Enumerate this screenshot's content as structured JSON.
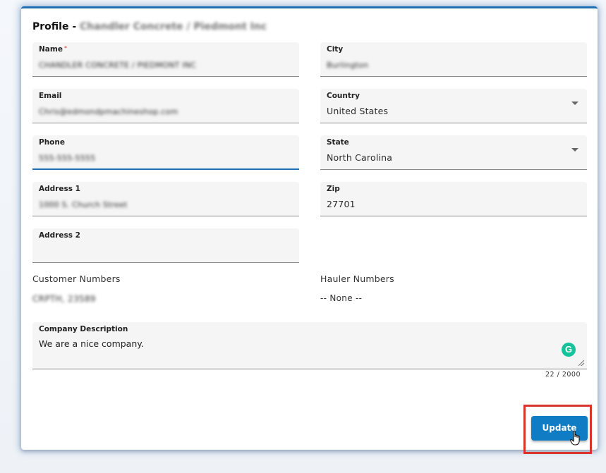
{
  "profile": {
    "title_prefix": "Profile -",
    "title_company": "Chandler Concrete / Piedmont Inc"
  },
  "fields": {
    "name": {
      "label": "Name",
      "required_mark": "*",
      "value": "CHANDLER CONCRETE / PIEDMONT INC"
    },
    "city": {
      "label": "City",
      "value": "Burlington"
    },
    "email": {
      "label": "Email",
      "value": "Chris@edmondpmachineshop.com"
    },
    "country": {
      "label": "Country",
      "value": "United States"
    },
    "phone": {
      "label": "Phone",
      "value": "555-555-5555"
    },
    "state": {
      "label": "State",
      "value": "North Carolina"
    },
    "address1": {
      "label": "Address 1",
      "value": "1000 S. Church Street"
    },
    "zip": {
      "label": "Zip",
      "value": "27701"
    },
    "address2": {
      "label": "Address 2",
      "value": ""
    }
  },
  "customer_numbers": {
    "label": "Customer Numbers",
    "value": "CRPTH, 23589"
  },
  "hauler_numbers": {
    "label": "Hauler Numbers",
    "value": "-- None --"
  },
  "company_description": {
    "label": "Company Description",
    "value": "We are a nice company.",
    "counter": "22 / 2000",
    "grammarly_glyph": "G"
  },
  "actions": {
    "update_label": "Update"
  },
  "colors": {
    "accent": "#0f7cc4",
    "highlight": "#d9342b",
    "grammarly": "#15c39a"
  },
  "icons": [
    "dropdown-caret-icon",
    "grammarly-icon",
    "resize-handle-icon",
    "hand-pointer-icon"
  ]
}
